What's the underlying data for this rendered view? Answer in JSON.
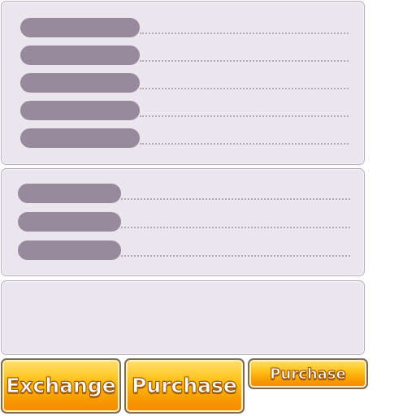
{
  "buttons": {
    "exchange_label": "Exchange",
    "purchase_label": "Purchase",
    "purchase_small_label": "Purchase"
  },
  "colors": {
    "panel_background": "#ebe6ee",
    "panel_border": "#b7adbb",
    "placeholder_pill": "#978a9c",
    "button_orange": "#f79b00",
    "button_yellow": "#ffe070"
  }
}
